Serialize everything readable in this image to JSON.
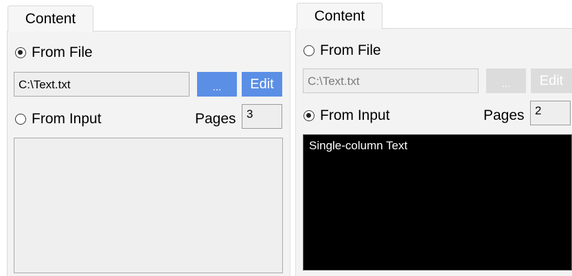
{
  "left_panel": {
    "tab_label": "Content",
    "from_file_label": "From File",
    "from_file_selected": true,
    "file_path": "C:\\Text.txt",
    "browse_label": "...",
    "edit_label": "Edit",
    "from_input_label": "From Input",
    "from_input_selected": false,
    "pages_label": "Pages",
    "pages_value": "3",
    "input_text": ""
  },
  "right_panel": {
    "tab_label": "Content",
    "from_file_label": "From File",
    "from_file_selected": false,
    "file_path": "C:\\Text.txt",
    "browse_label": "...",
    "edit_label": "Edit",
    "from_input_label": "From Input",
    "from_input_selected": true,
    "pages_label": "Pages",
    "pages_value": "2",
    "input_text": "Single-column Text"
  },
  "colors": {
    "accent_button": "#5b8fe6",
    "disabled_button": "#dcdcdc",
    "input_area_dark": "#000000"
  }
}
